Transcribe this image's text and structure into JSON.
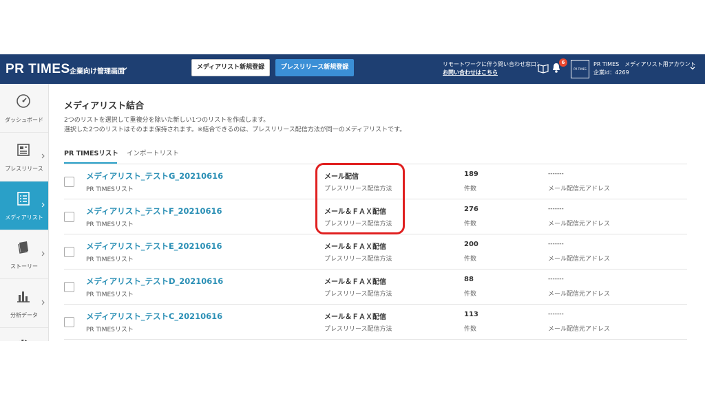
{
  "header": {
    "logo": "PR TIMES",
    "admin_label": "企業向け管理画面",
    "new_media_list_button": "メディアリスト新規登録",
    "new_press_release_button": "プレスリリース新規登録",
    "remote_work_text": "リモートワークに伴う問い合わせ窓口：",
    "contact_link": "お問い合わせはこちら",
    "notification_count": "6",
    "account_logo_text": "PR TIMES",
    "account_name": "PR TIMES　メディアリスト用アカウント",
    "company_id": "企業id：4269"
  },
  "sidebar": {
    "items": [
      {
        "label": "ダッシュボード"
      },
      {
        "label": "プレスリリース"
      },
      {
        "label": "メディアリスト"
      },
      {
        "label": "ストーリー"
      },
      {
        "label": "分析データ"
      }
    ]
  },
  "main": {
    "title": "メディアリスト結合",
    "description_line1": "2つのリストを選択して重複分を除いた新しい1つのリストを作成します。",
    "description_line2": "選択した2つのリストはそのまま保持されます。※結合できるのは、プレスリリース配信方法が同一のメディアリストです。",
    "tabs": [
      {
        "label": "PR TIMESリスト"
      },
      {
        "label": "インポートリスト"
      }
    ],
    "rows": [
      {
        "name": "メディアリスト_テストG_20210616",
        "type": "PR TIMESリスト",
        "method": "メール配信",
        "method_label": "プレスリリース配信方法",
        "count": "189",
        "count_label": "件数",
        "address": "-------",
        "address_label": "メール配信元アドレス"
      },
      {
        "name": "メディアリスト_テストF_20210616",
        "type": "PR TIMESリスト",
        "method": "メール＆ＦＡＸ配信",
        "method_label": "プレスリリース配信方法",
        "count": "276",
        "count_label": "件数",
        "address": "-------",
        "address_label": "メール配信元アドレス"
      },
      {
        "name": "メディアリスト_テストE_20210616",
        "type": "PR TIMESリスト",
        "method": "メール＆ＦＡＸ配信",
        "method_label": "プレスリリース配信方法",
        "count": "200",
        "count_label": "件数",
        "address": "-------",
        "address_label": "メール配信元アドレス"
      },
      {
        "name": "メディアリスト_テストD_20210616",
        "type": "PR TIMESリスト",
        "method": "メール＆ＦＡＸ配信",
        "method_label": "プレスリリース配信方法",
        "count": "88",
        "count_label": "件数",
        "address": "-------",
        "address_label": "メール配信元アドレス"
      },
      {
        "name": "メディアリスト_テストC_20210616",
        "type": "PR TIMESリスト",
        "method": "メール＆ＦＡＸ配信",
        "method_label": "プレスリリース配信方法",
        "count": "113",
        "count_label": "件数",
        "address": "-------",
        "address_label": "メール配信元アドレス"
      }
    ]
  },
  "colors": {
    "header_bg": "#1e3f72",
    "accent": "#2aa0c8",
    "primary_button": "#3b8fd6",
    "highlight": "#e02020"
  }
}
